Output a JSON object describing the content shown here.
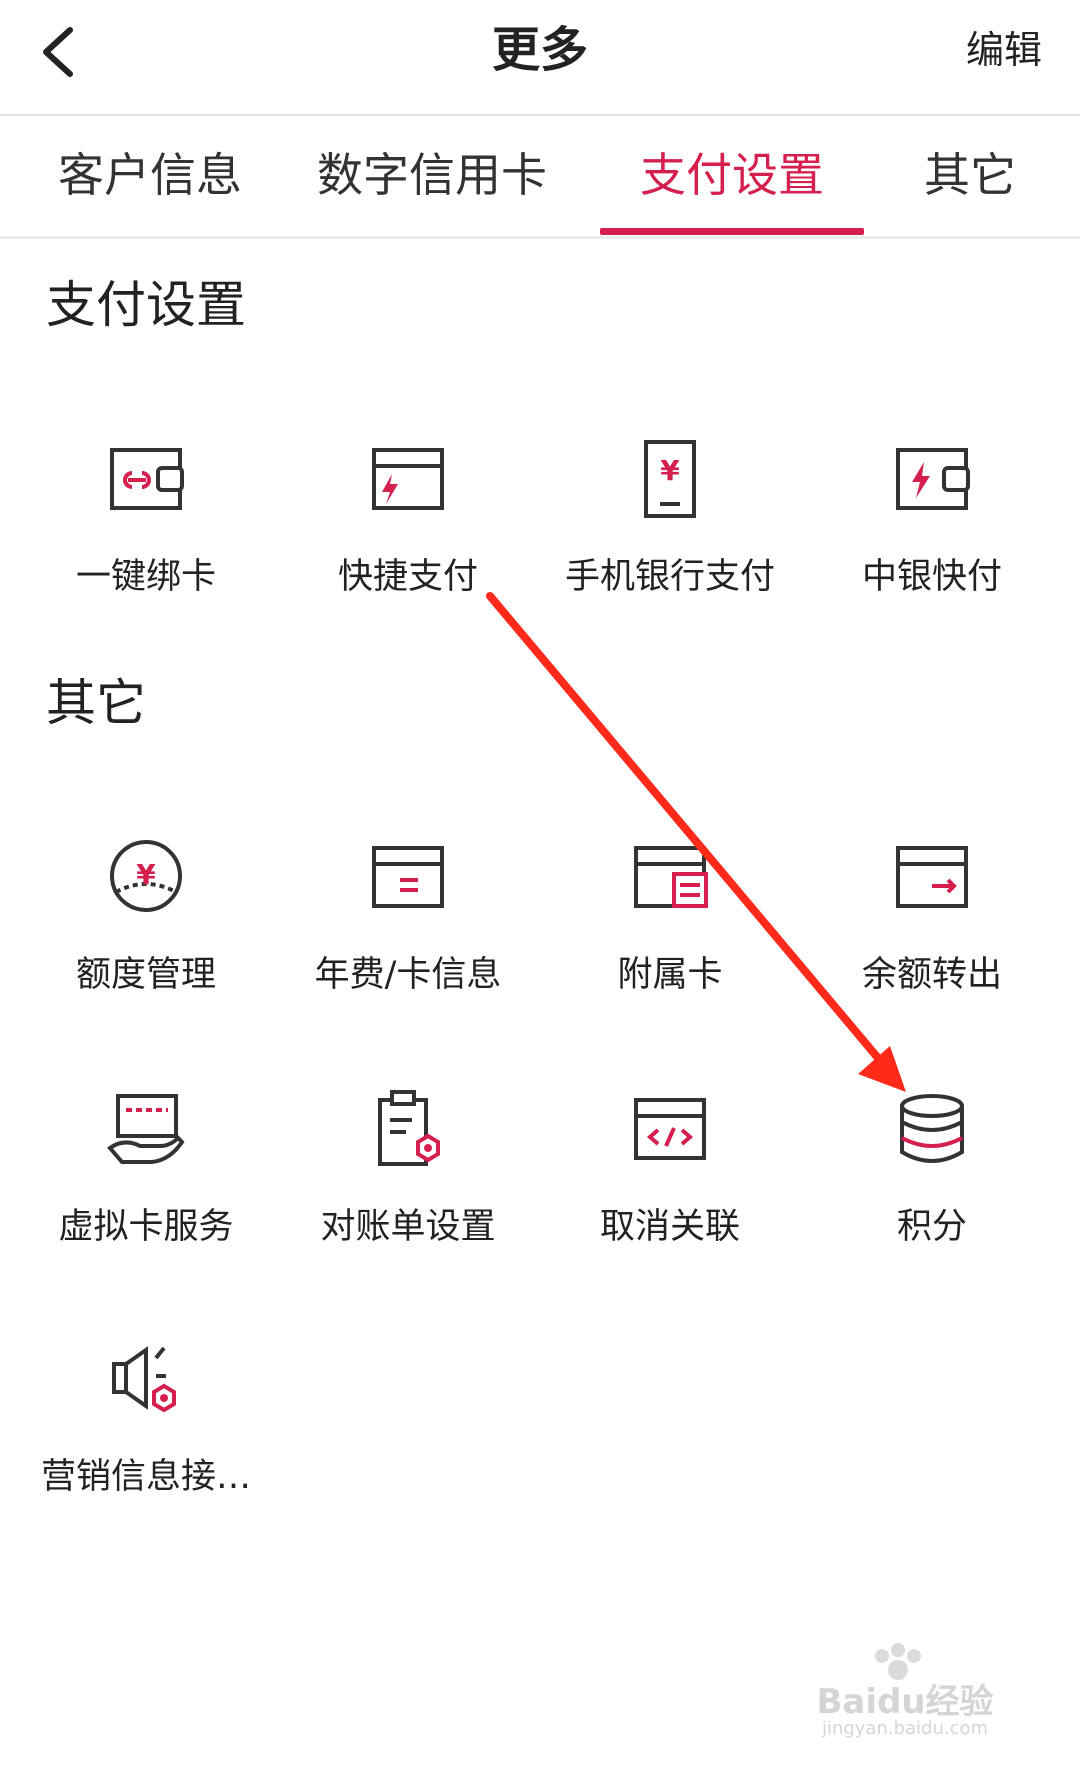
{
  "header": {
    "title": "更多",
    "edit_label": "编辑"
  },
  "tabs": [
    {
      "label": "客户信息",
      "active": false
    },
    {
      "label": "数字信用卡",
      "active": false
    },
    {
      "label": "支付设置",
      "active": true
    },
    {
      "label": "其它",
      "active": false
    }
  ],
  "sections": {
    "payment": {
      "title": "支付设置",
      "items": [
        {
          "label": "一键绑卡",
          "icon": "wallet-link-icon"
        },
        {
          "label": "快捷支付",
          "icon": "card-lightning-icon"
        },
        {
          "label": "手机银行支付",
          "icon": "phone-yuan-icon"
        },
        {
          "label": "中银快付",
          "icon": "wallet-lightning-icon"
        }
      ]
    },
    "other": {
      "title": "其它",
      "items": [
        {
          "label": "额度管理",
          "icon": "yuan-gauge-icon"
        },
        {
          "label": "年费/卡信息",
          "icon": "card-info-icon"
        },
        {
          "label": "附属卡",
          "icon": "supplementary-card-icon"
        },
        {
          "label": "余额转出",
          "icon": "card-transfer-out-icon"
        },
        {
          "label": "虚拟卡服务",
          "icon": "hand-card-icon"
        },
        {
          "label": "对账单设置",
          "icon": "statement-settings-icon"
        },
        {
          "label": "取消关联",
          "icon": "card-code-icon"
        },
        {
          "label": "积分",
          "icon": "coin-stack-icon"
        },
        {
          "label": "营销信息接…",
          "icon": "speaker-settings-icon"
        }
      ]
    }
  },
  "watermark": {
    "text": "Baidu经验",
    "subtext": "jingyan.baidu.com"
  },
  "colors": {
    "accent": "#d51f4f",
    "icon_stroke": "#333333",
    "annotation_arrow": "#ff2a1a"
  }
}
